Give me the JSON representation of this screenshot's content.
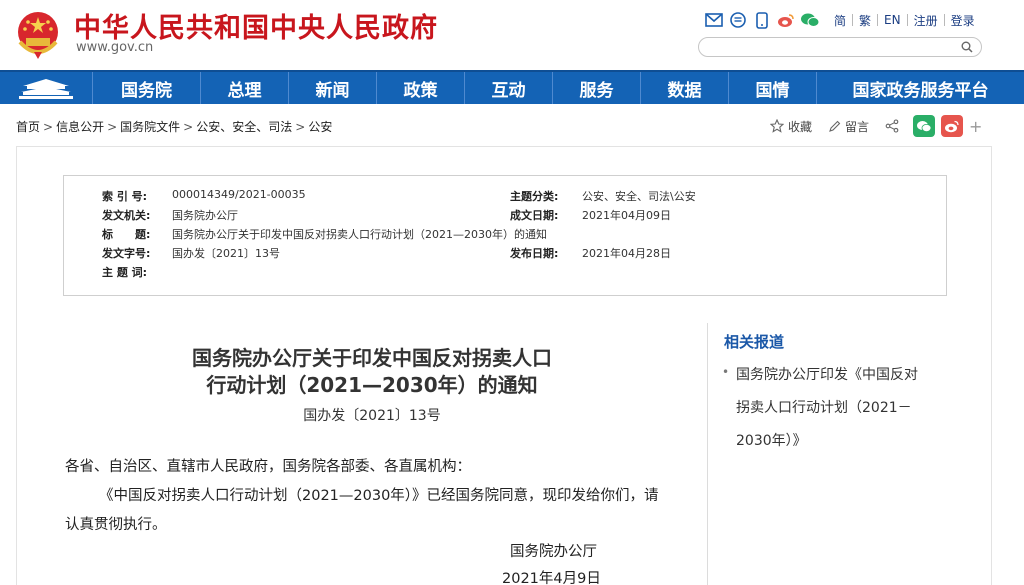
{
  "header": {
    "site_title": "中华人民共和国中央人民政府",
    "site_url": "www.gov.cn",
    "top_links": [
      "简",
      "繁",
      "EN",
      "注册",
      "登录"
    ],
    "search_placeholder": ""
  },
  "nav": {
    "items": [
      "国务院",
      "总理",
      "新闻",
      "政策",
      "互动",
      "服务",
      "数据",
      "国情",
      "国家政务服务平台"
    ],
    "bg_color": "#1463b5"
  },
  "breadcrumb": [
    "首页",
    "信息公开",
    "国务院文件",
    "公安、安全、司法",
    "公安"
  ],
  "actions": {
    "favorite": "收藏",
    "comment": "留言"
  },
  "meta": {
    "index_no_label": "索 引 号:",
    "index_no": "000014349/2021-00035",
    "category_label": "主题分类:",
    "category": "公安、安全、司法\\公安",
    "issuer_label": "发文机关:",
    "issuer": "国务院办公厅",
    "written_date_label": "成文日期:",
    "written_date": "2021年04月09日",
    "title_label": "标　　题:",
    "title": "国务院办公厅关于印发中国反对拐卖人口行动计划（2021—2030年）的通知",
    "doc_no_label": "发文字号:",
    "doc_no": "国办发〔2021〕13号",
    "publish_date_label": "发布日期:",
    "publish_date": "2021年04月28日",
    "keywords_label": "主 题 词:",
    "keywords": ""
  },
  "document": {
    "title_line1": "国务院办公厅关于印发中国反对拐卖人口",
    "title_line2": "行动计划（2021—2030年）的通知",
    "doc_no": "国办发〔2021〕13号",
    "salutation": "各省、自治区、直辖市人民政府，国务院各部委、各直属机构：",
    "body_line1": "《中国反对拐卖人口行动计划（2021—2030年）》已经国务院同意，现印发给你们，请",
    "body_line2": "认真贯彻执行。",
    "signature": "国务院办公厅",
    "date": "2021年4月9日"
  },
  "related": {
    "title": "相关报道",
    "link_line1": "国务院办公厅印发《中国反对",
    "link_line2": "拐卖人口行动计划（2021－",
    "link_line3": "2030年）》"
  },
  "colors": {
    "brand_red": "#c8161d",
    "nav_blue": "#1463b5",
    "link_blue": "#1b58a8",
    "wechat_green": "#2aae67",
    "weibo_red": "#e6554d"
  }
}
